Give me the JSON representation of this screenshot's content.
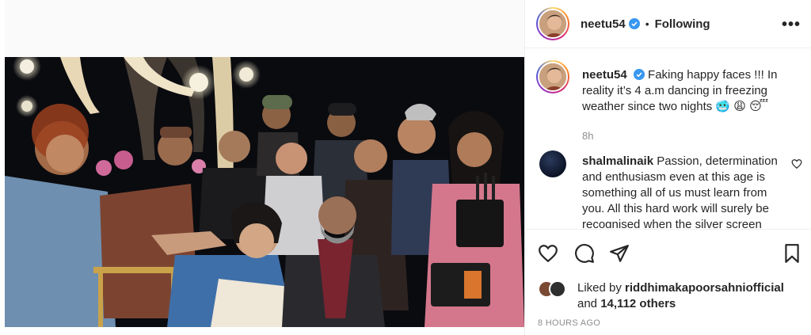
{
  "post": {
    "username": "neetu54",
    "follow_status": "Following",
    "more_label": "•••",
    "caption": {
      "username": "neetu54",
      "text": "Faking happy faces !!! In reality it’s 4 a.m dancing in freezing weather since two nights 🥶 😩 😴",
      "time": "8h"
    },
    "comment": {
      "username": "shalmalinaik",
      "text": "Passion, determination and enthusiasm even at this age is something all of us must learn from you. All this hard work will surely be recognised when the silver screen"
    },
    "likes": {
      "prefix": "Liked by",
      "user": "riddhimakapoorsahniofficial",
      "and": "and",
      "count": "14,112 others"
    },
    "posted_ago": "8 HOURS AGO"
  },
  "icons": [
    "verified-badge-icon",
    "more-options-icon",
    "like-heart-icon",
    "comment-icon",
    "share-icon",
    "save-bookmark-icon",
    "comment-like-icon"
  ],
  "colors": {
    "verified": "#3897f0",
    "secondary_text": "#8e8e8e",
    "border": "#efefef"
  }
}
